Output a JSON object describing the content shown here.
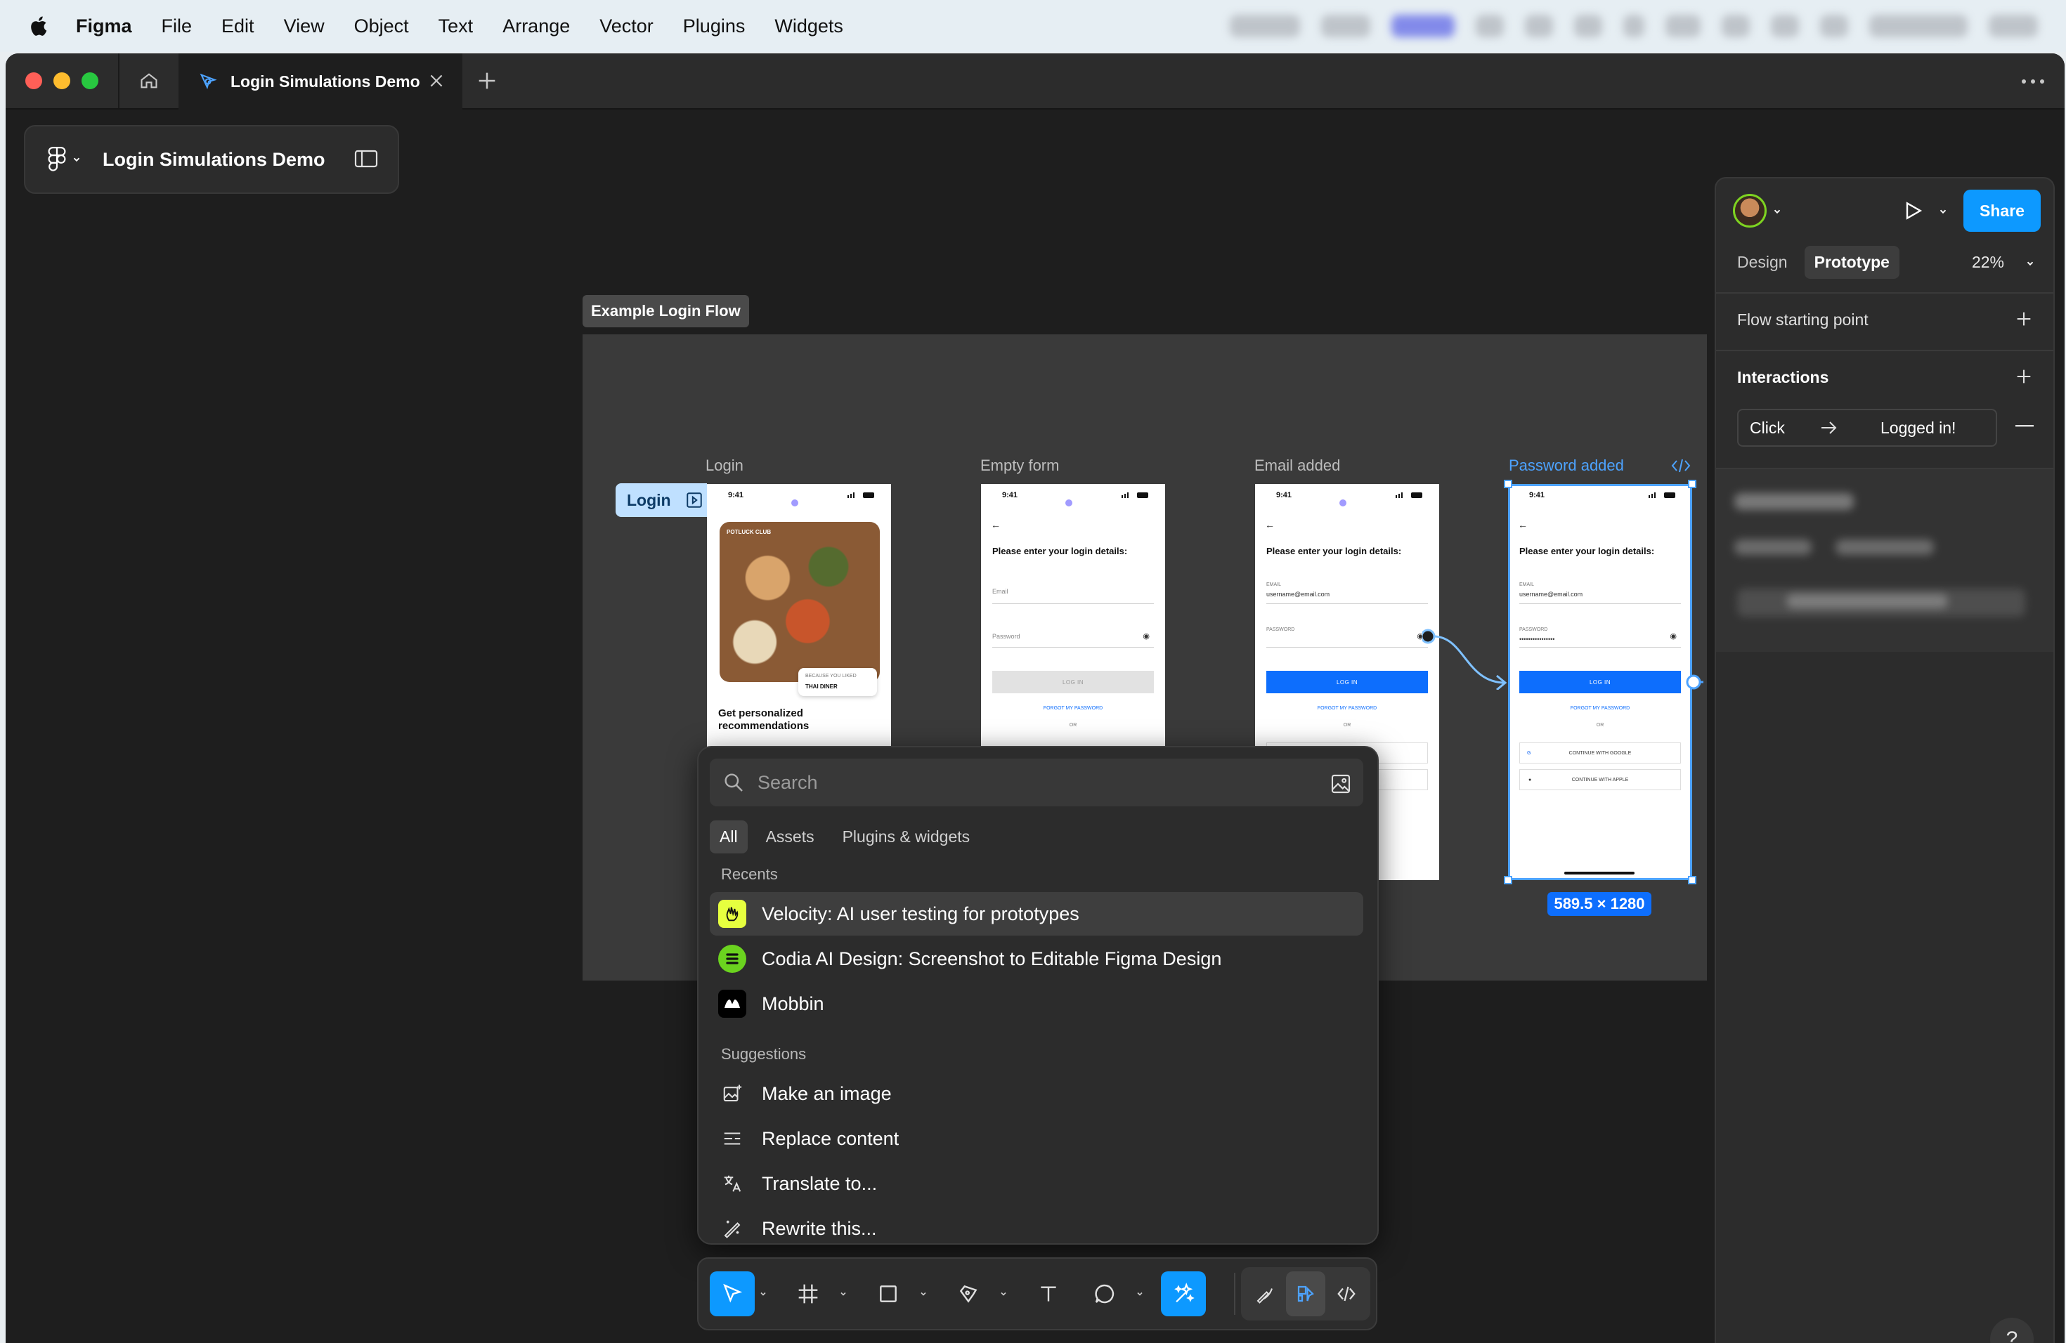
{
  "menubar": {
    "app": "Figma",
    "items": [
      "File",
      "Edit",
      "View",
      "Object",
      "Text",
      "Arrange",
      "Vector",
      "Plugins",
      "Widgets"
    ]
  },
  "tabbar": {
    "doc_tab_title": "Login Simulations Demo"
  },
  "file_header": {
    "title": "Login Simulations Demo"
  },
  "canvas": {
    "section_label": "Example Login Flow",
    "frames": [
      {
        "label": "Login"
      },
      {
        "label": "Empty form"
      },
      {
        "label": "Email added"
      },
      {
        "label": "Password added"
      }
    ],
    "login_chip": "Login",
    "selection_size": "589.5 × 1280",
    "phones": {
      "time": "9:41",
      "heading": "Please enter your login details:",
      "email_label": "Email",
      "email_label_caps": "EMAIL",
      "email_value": "username@email.com",
      "password_label": "Password",
      "password_label_caps": "PASSWORD",
      "password_value": "••••••••••••••••",
      "login_button": "LOG IN",
      "forgot_password": "FORGOT MY PASSWORD",
      "or": "OR",
      "google": "CONTINUE WITH GOOGLE",
      "apple": "CONTINUE WITH APPLE",
      "potluck_tag": "POTLUCK CLUB",
      "because_you_liked": "BECAUSE YOU LIKED",
      "restaurant": "THAI DINER",
      "promo": "Get personalized recommendations"
    }
  },
  "quick_actions": {
    "search_placeholder": "Search",
    "tabs": [
      "All",
      "Assets",
      "Plugins & widgets"
    ],
    "recents_label": "Recents",
    "recents": [
      "Velocity: AI user testing for prototypes",
      "Codia AI Design: Screenshot to Editable Figma Design",
      "Mobbin"
    ],
    "suggestions_label": "Suggestions",
    "suggestions": [
      "Make an image",
      "Replace content",
      "Translate to...",
      "Rewrite this..."
    ]
  },
  "right_panel": {
    "share": "Share",
    "tabs": [
      "Design",
      "Prototype"
    ],
    "active_tab": "Prototype",
    "zoom": "22%",
    "flow_starting_point": "Flow starting point",
    "interactions": "Interactions",
    "interaction": {
      "trigger": "Click",
      "destination": "Logged in!"
    }
  },
  "colors": {
    "accent": "#0d99ff",
    "selection": "#4da3ff",
    "canvas": "#1e1e1e"
  }
}
